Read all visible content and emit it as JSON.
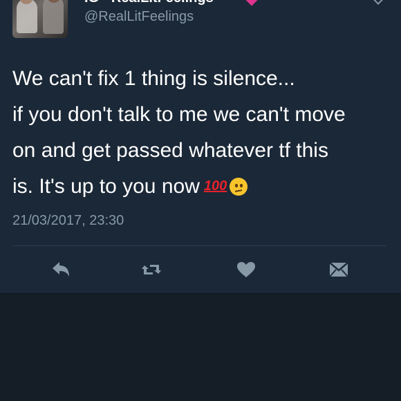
{
  "tweet": {
    "display_name": "IG - RealLitFeelings",
    "handle": "@RealLitFeelings",
    "text_lines": [
      "We can't fix 1 thing is silence...",
      "if you don't talk to me we can't move",
      "on and get passed whatever tf this",
      "is. It's up to you now"
    ],
    "emoji_100": "100",
    "timestamp": "21/03/2017, 23:30"
  },
  "actions": {
    "reply_icon": "reply-icon",
    "retweet_icon": "retweet-icon",
    "like_icon": "heart-icon",
    "dm_icon": "direct-message-icon"
  },
  "colors": {
    "background": "#151d27",
    "card": "#1b2837",
    "muted_text": "#8899a6",
    "icon": "#8899a6",
    "accent_gem": "#e0338f",
    "emoji_100": "#e8222b"
  }
}
